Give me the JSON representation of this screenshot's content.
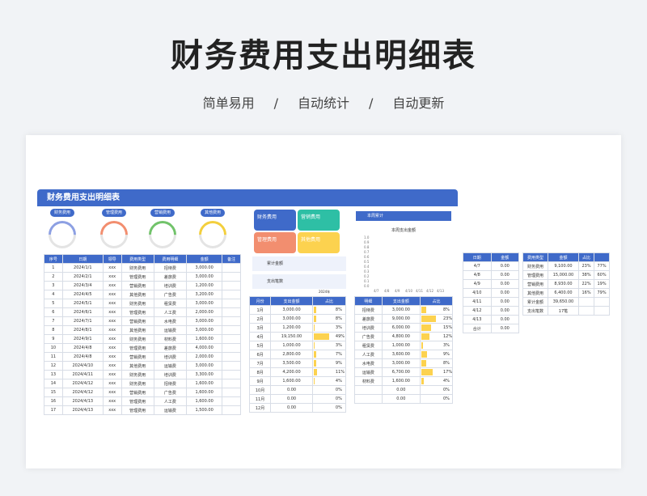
{
  "hero": {
    "title": "财务费用支出明细表",
    "features": [
      "简单易用",
      "/",
      "自动统计",
      "/",
      "自动更新"
    ]
  },
  "sheet_title": "财务费用支出明细表",
  "category_pills": [
    "财务费用",
    "管理费用",
    "营销费用",
    "其他费用"
  ],
  "ring_colors": [
    "#8da0e3",
    "#f28e6f",
    "#72c36b",
    "#f3cf3e"
  ],
  "detail_table": {
    "headers": [
      "序号",
      "日期",
      "领导",
      "费用类型",
      "费用明细",
      "金额",
      "备注"
    ],
    "rows": [
      [
        "1",
        "2024/1/1",
        "xxx",
        "财务费用",
        "招待费",
        "3,000.00",
        ""
      ],
      [
        "2",
        "2024/2/1",
        "xxx",
        "管理费用",
        "差旅费",
        "3,000.00",
        ""
      ],
      [
        "3",
        "2024/3/4",
        "xxx",
        "营销费用",
        "培训费",
        "1,200.00",
        ""
      ],
      [
        "4",
        "2024/4/5",
        "xxx",
        "其他费用",
        "广告费",
        "3,200.00",
        ""
      ],
      [
        "5",
        "2024/5/1",
        "xxx",
        "财务费用",
        "租赁费",
        "3,000.00",
        ""
      ],
      [
        "6",
        "2024/6/1",
        "xxx",
        "管理费用",
        "人工费",
        "2,000.00",
        ""
      ],
      [
        "7",
        "2024/7/1",
        "xxx",
        "营销费用",
        "水电费",
        "3,000.00",
        ""
      ],
      [
        "8",
        "2024/8/1",
        "xxx",
        "其他费用",
        "运输费",
        "3,000.00",
        ""
      ],
      [
        "9",
        "2024/9/1",
        "xxx",
        "财务费用",
        "材料费",
        "1,600.00",
        ""
      ],
      [
        "10",
        "2024/4/8",
        "xxx",
        "管理费用",
        "差旅费",
        "4,000.00",
        ""
      ],
      [
        "11",
        "2024/4/8",
        "xxx",
        "营销费用",
        "培训费",
        "2,000.00",
        ""
      ],
      [
        "12",
        "2024/4/10",
        "xxx",
        "其他费用",
        "运输费",
        "3,000.00",
        ""
      ],
      [
        "13",
        "2024/4/11",
        "xxx",
        "财务费用",
        "培训费",
        "3,300.00",
        ""
      ],
      [
        "14",
        "2024/4/12",
        "xxx",
        "财务费用",
        "招待费",
        "1,600.00",
        ""
      ],
      [
        "15",
        "2024/4/12",
        "xxx",
        "营销费用",
        "广告费",
        "1,600.00",
        ""
      ],
      [
        "16",
        "2024/4/13",
        "xxx",
        "管理费用",
        "人工费",
        "1,600.00",
        ""
      ],
      [
        "17",
        "2024/4/13",
        "xxx",
        "管理费用",
        "运输费",
        "1,500.00",
        ""
      ]
    ]
  },
  "cards": [
    {
      "label": "财务费用",
      "color": "#3f6ac9"
    },
    {
      "label": "营销费用",
      "color": "#2ebfa5"
    },
    {
      "label": "管理费用",
      "color": "#f28e6f"
    },
    {
      "label": "其他费用",
      "color": "#fcd24f"
    }
  ],
  "info": {
    "total": "累计金额",
    "count": "支出笔数"
  },
  "year_label": "2024年",
  "month_table": {
    "headers": [
      "月份",
      "支出金额",
      "占比"
    ],
    "rows": [
      [
        "1月",
        "3,000.00",
        "8%",
        8
      ],
      [
        "2月",
        "3,000.00",
        "8%",
        8
      ],
      [
        "3月",
        "1,200.00",
        "3%",
        3
      ],
      [
        "4月",
        "19,150.00",
        "49%",
        49
      ],
      [
        "5月",
        "1,000.00",
        "3%",
        3
      ],
      [
        "6月",
        "2,800.00",
        "7%",
        7
      ],
      [
        "7月",
        "3,500.00",
        "9%",
        9
      ],
      [
        "8月",
        "4,200.00",
        "11%",
        11
      ],
      [
        "9月",
        "1,600.00",
        "4%",
        4
      ],
      [
        "10月",
        "0.00",
        "0%",
        0
      ],
      [
        "11月",
        "0.00",
        "0%",
        0
      ],
      [
        "12月",
        "0.00",
        "0%",
        0
      ]
    ]
  },
  "week_panel": {
    "header": "本周累计",
    "chart_title": "本周支出金额",
    "y_ticks": [
      "1.0",
      "0.9",
      "0.8",
      "0.7",
      "0.6",
      "0.5",
      "0.4",
      "0.3",
      "0.2",
      "0.1",
      "0.0"
    ],
    "x_ticks": [
      "4/7",
      "4/8",
      "4/9",
      "4/10",
      "4/11",
      "4/12",
      "4/13"
    ]
  },
  "detail_sum_table": {
    "headers": [
      "明细",
      "支出金额",
      "占比"
    ],
    "rows": [
      [
        "招待费",
        "3,000.00",
        "8%",
        8
      ],
      [
        "差旅费",
        "9,000.00",
        "23%",
        23
      ],
      [
        "培训费",
        "6,000.00",
        "15%",
        15
      ],
      [
        "广告费",
        "4,800.00",
        "12%",
        12
      ],
      [
        "租赁费",
        "1,000.00",
        "3%",
        3
      ],
      [
        "人工费",
        "3,600.00",
        "9%",
        9
      ],
      [
        "水电费",
        "3,000.00",
        "8%",
        8
      ],
      [
        "运输费",
        "6,700.00",
        "17%",
        17
      ],
      [
        "材料费",
        "1,600.00",
        "4%",
        4
      ],
      [
        "",
        "0.00",
        "0%",
        0
      ],
      [
        "",
        "0.00",
        "0%",
        0
      ]
    ]
  },
  "date_table": {
    "headers": [
      "日期",
      "金额"
    ],
    "rows": [
      [
        "4/7",
        "0.00"
      ],
      [
        "4/8",
        "0.00"
      ],
      [
        "4/9",
        "0.00"
      ],
      [
        "4/10",
        "0.00"
      ],
      [
        "4/11",
        "0.00"
      ],
      [
        "4/12",
        "0.00"
      ],
      [
        "4/13",
        "0.00"
      ],
      [
        "合计",
        "0.00"
      ]
    ]
  },
  "type_table": {
    "headers": [
      "费用类型",
      "金额",
      "占比",
      ""
    ],
    "rows": [
      [
        "财务费用",
        "9,100.00",
        "23%",
        "77%"
      ],
      [
        "管理费用",
        "15,000.00",
        "38%",
        "60%"
      ],
      [
        "营销费用",
        "8,930.00",
        "22%",
        "19%"
      ],
      [
        "其他费用",
        "6,400.00",
        "16%",
        "79%"
      ],
      [
        "累计金额",
        "39,650.00",
        "",
        ""
      ],
      [
        "支出笔数",
        "17笔",
        "",
        ""
      ]
    ]
  }
}
